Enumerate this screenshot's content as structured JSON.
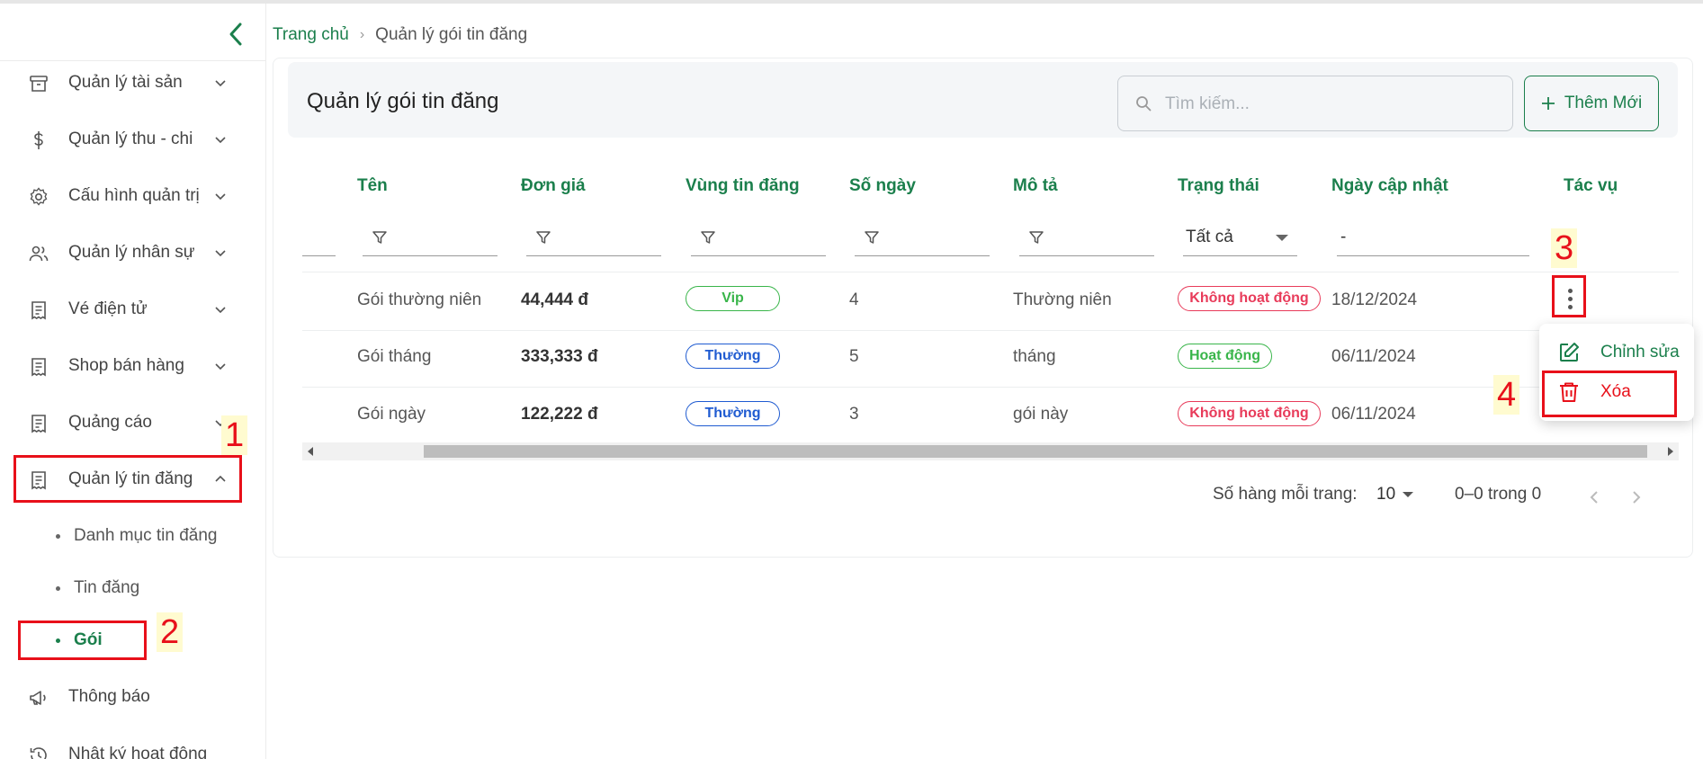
{
  "sidebar": {
    "items": [
      {
        "label": "Quản lý tài sản",
        "icon": "archive-icon"
      },
      {
        "label": "Quản lý thu - chi",
        "icon": "dollar-icon"
      },
      {
        "label": "Cấu hình quản trị",
        "icon": "gear-icon"
      },
      {
        "label": "Quản lý nhân sự",
        "icon": "users-icon"
      },
      {
        "label": "Vé điện tử",
        "icon": "receipt-icon"
      },
      {
        "label": "Shop bán hàng",
        "icon": "receipt-icon"
      },
      {
        "label": "Quảng cáo",
        "icon": "receipt-icon"
      },
      {
        "label": "Quản lý tin đăng",
        "icon": "receipt-icon"
      },
      {
        "label": "Thông báo",
        "icon": "megaphone-icon"
      },
      {
        "label": "Nhật ký hoạt động",
        "icon": "history-icon"
      }
    ],
    "subitems": [
      {
        "label": "Danh mục tin đăng"
      },
      {
        "label": "Tin đăng"
      },
      {
        "label": "Gói"
      }
    ]
  },
  "annotations": [
    "1",
    "2",
    "3",
    "4"
  ],
  "breadcrumb": {
    "home": "Trang chủ",
    "separator": "›",
    "current": "Quản lý gói tin đăng"
  },
  "page": {
    "title": "Quản lý gói tin đăng"
  },
  "search": {
    "placeholder": "Tìm kiếm..."
  },
  "add_button": {
    "label": "Thêm Mới"
  },
  "table": {
    "columns": [
      "Tên",
      "Đơn giá",
      "Vùng tin đăng",
      "Số ngày",
      "Mô tả",
      "Trạng thái",
      "Ngày cập nhật",
      "Tác vụ"
    ],
    "filters": {
      "status": "Tất cả",
      "date": "-"
    },
    "rows": [
      {
        "name": "Gói thường niên",
        "price": "44,444 đ",
        "region": "Vip",
        "days": "4",
        "desc": "Thường niên",
        "status": "Không hoạt động",
        "updated": "18/12/2024"
      },
      {
        "name": "Gói tháng",
        "price": "333,333 đ",
        "region": "Thường",
        "days": "5",
        "desc": "tháng",
        "status": "Hoạt động",
        "updated": "06/11/2024"
      },
      {
        "name": "Gói ngày",
        "price": "122,222 đ",
        "region": "Thường",
        "days": "3",
        "desc": "gói này",
        "status": "Không hoạt động",
        "updated": "06/11/2024"
      }
    ]
  },
  "pagination": {
    "rows_per_page_label": "Số hàng mỗi trang:",
    "rows_per_page": "10",
    "range": "0–0 trong 0"
  },
  "action_menu": {
    "edit": "Chỉnh sửa",
    "delete": "Xóa"
  },
  "colors": {
    "primary": "#1b7f4c",
    "danger": "#e8101a",
    "vip": "#39b54a",
    "normal": "#1f5bd1",
    "inactive": "#e83b5a"
  }
}
